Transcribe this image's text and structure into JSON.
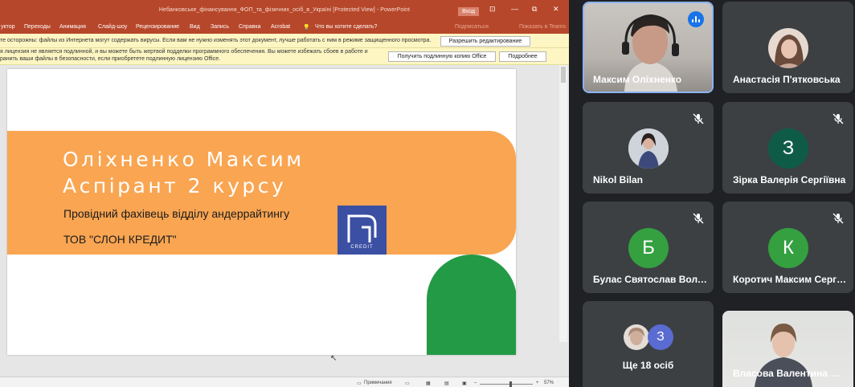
{
  "ppt": {
    "title": "Небанковське_фінансування_ФОП_та_фізичних_осіб_в_Україні  [Protected View]  -  PowerPoint",
    "signin": "Вход",
    "ribbon_tabs": [
      "уктор",
      "Переходы",
      "Анимация",
      "Слайд-шоу",
      "Рецензирование",
      "Вид",
      "Запись",
      "Справка",
      "Acrobat"
    ],
    "tell_me": "Что вы хотите сделать?",
    "sign_in_hint": "Подписаться",
    "share_hint": "Показать в Teams",
    "protected_msg": "те осторожны: файлы из Интернета могут содержать вирусы. Если вам не нужно изменять этот документ, лучше работать с ним в режиме защищенного просмотра.",
    "enable_editing": "Разрешить редактирование",
    "license_msg_1": "я лицензия не является подлинной, и вы можете быть жертвой подделки программного обеспечения. Вы можете избежать сбоев в работе и",
    "license_msg_2": "ранить ваши файлы в безопасности, если приобретете подлинную лицензию Office.",
    "get_genuine": "Получить подлинную копию Office",
    "learn_more": "Подробнее",
    "slide": {
      "name_line": "Оліхненко Максим",
      "role_line": "Аспірант 2 курсу",
      "position_line": "Провідний фахівець  відділу андеррайтингу",
      "company_line": "ТОВ \"СЛОН КРЕДИТ\"",
      "logo_text": "CREDIT"
    },
    "status": {
      "notes": "Примечания",
      "zoom": "57%",
      "zoom_level": 0.57
    }
  },
  "meet": {
    "tiles": [
      {
        "name": "Максим Оліхненко",
        "type": "video",
        "speaking": true
      },
      {
        "name": "Анастасія П'ятковська",
        "type": "photo",
        "muted": false
      },
      {
        "name": "Nikol Bilan",
        "type": "photo",
        "muted": true
      },
      {
        "name": "Зірка Валерія Сергіївна",
        "type": "letter",
        "letter": "З",
        "color": "#0e5c48",
        "muted": true
      },
      {
        "name": "Булас Святослав Воло…",
        "type": "letter",
        "letter": "Б",
        "color": "#34a040",
        "muted": true
      },
      {
        "name": "Коротич Максим Серг…",
        "type": "letter",
        "letter": "К",
        "color": "#34a040",
        "muted": true
      },
      {
        "name": "Ще 18 осіб",
        "type": "more",
        "letter": "З",
        "color": "#5a6bd1"
      },
      {
        "name": "Власова Валентина П…",
        "type": "video"
      }
    ]
  }
}
